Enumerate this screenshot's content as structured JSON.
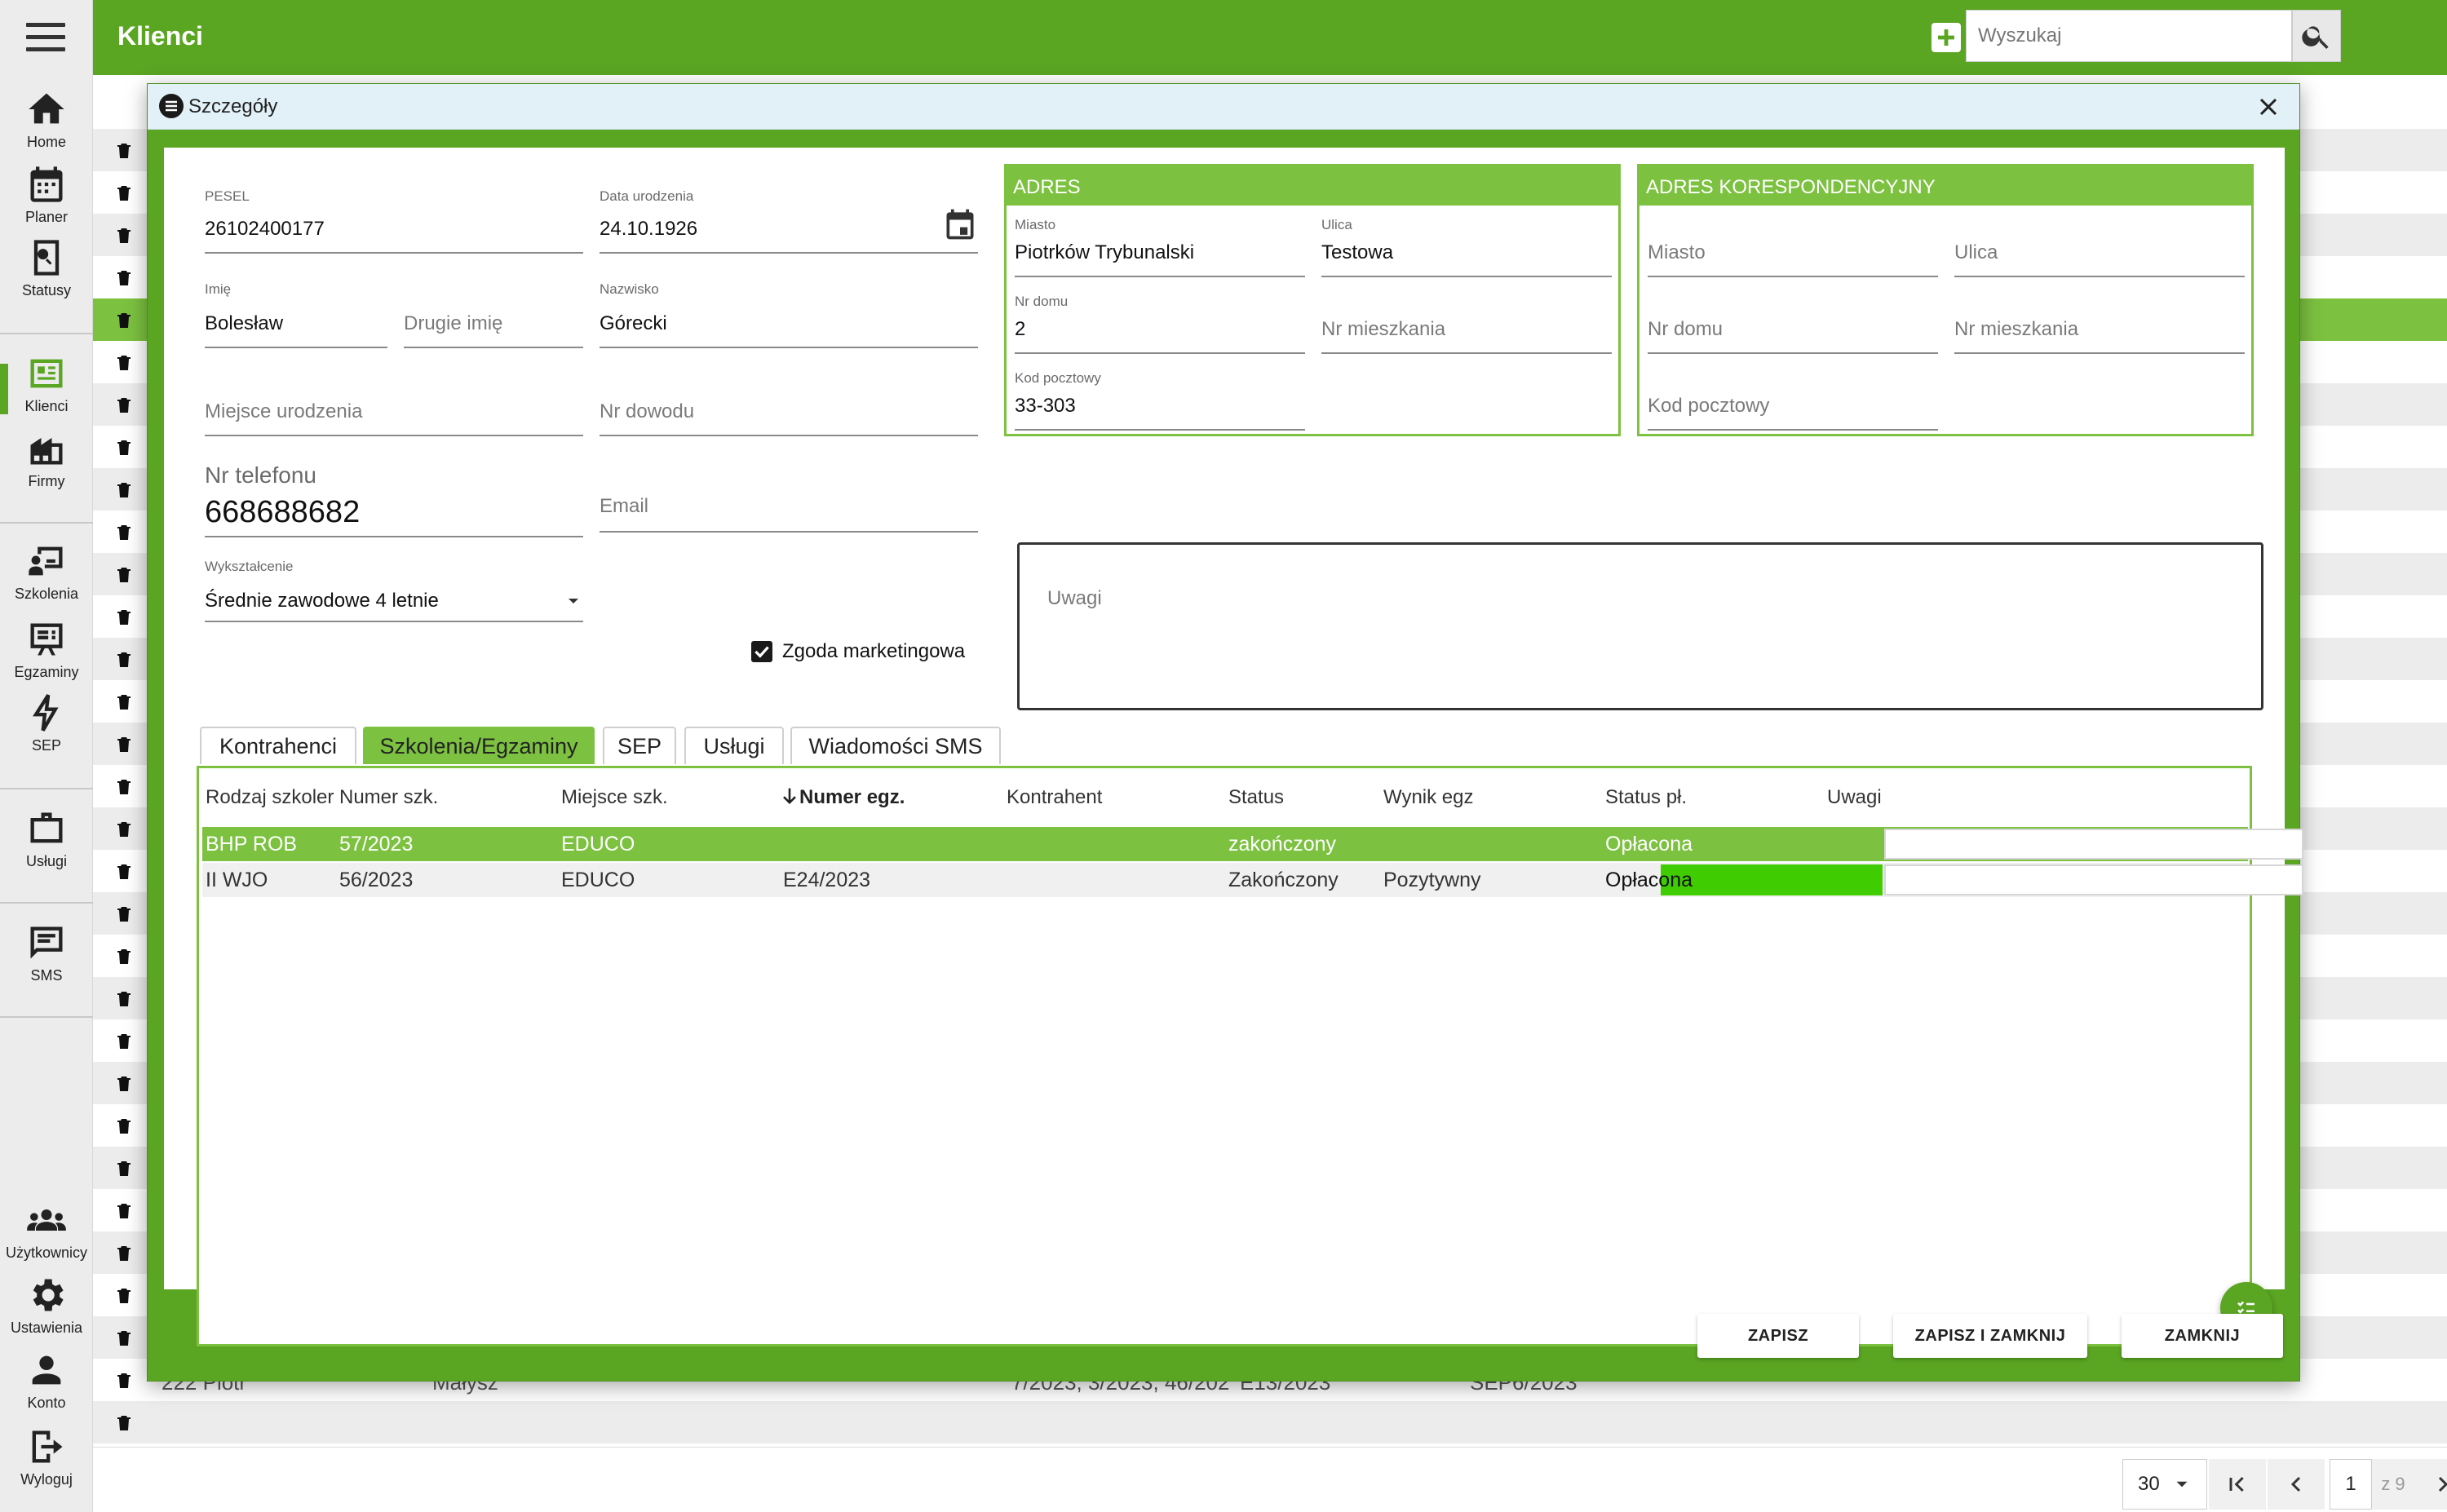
{
  "app": {
    "title": "Klienci",
    "search_placeholder": "Wyszukaj"
  },
  "sidebar": {
    "items": [
      {
        "label": "Home",
        "icon": "home-icon"
      },
      {
        "label": "Planer",
        "icon": "calendar-icon"
      },
      {
        "label": "Statusy",
        "icon": "status-search-icon"
      },
      {
        "label": "Klienci",
        "icon": "client-card-icon",
        "active": true
      },
      {
        "label": "Firmy",
        "icon": "building-icon"
      },
      {
        "label": "Szkolenia",
        "icon": "training-icon"
      },
      {
        "label": "Egzaminy",
        "icon": "exam-icon"
      },
      {
        "label": "SEP",
        "icon": "lightning-icon"
      },
      {
        "label": "Usługi",
        "icon": "briefcase-icon"
      },
      {
        "label": "SMS",
        "icon": "message-icon"
      },
      {
        "label": "Użytkownicy",
        "icon": "users-icon"
      },
      {
        "label": "Ustawienia",
        "icon": "gear-icon"
      },
      {
        "label": "Konto",
        "icon": "account-icon"
      },
      {
        "label": "Wyloguj",
        "icon": "logout-icon"
      }
    ]
  },
  "background_row": {
    "name": "222 Piotr",
    "surname": "Małysz",
    "trainings": "7/2023, 3/2023, 46/202",
    "exams": "E13/2023",
    "sep": "SEP6/2023"
  },
  "pagination": {
    "page_size": "30",
    "current_page": "1",
    "total": "z 9"
  },
  "modal": {
    "title": "Szczegóły",
    "pesel": {
      "label": "PESEL",
      "value": "26102400177"
    },
    "birth_date": {
      "label": "Data urodzenia",
      "value": "24.10.1926"
    },
    "first_name": {
      "label": "Imię",
      "value": "Bolesław"
    },
    "second_name": {
      "placeholder": "Drugie imię"
    },
    "last_name": {
      "label": "Nazwisko",
      "value": "Górecki"
    },
    "birth_place": {
      "placeholder": "Miejsce urodzenia"
    },
    "id_number": {
      "placeholder": "Nr dowodu"
    },
    "phone": {
      "label": "Nr telefonu",
      "value": "668688682"
    },
    "email": {
      "placeholder": "Email"
    },
    "education": {
      "label": "Wykształcenie",
      "value": "Średnie zawodowe 4 letnie"
    },
    "marketing_consent": {
      "label": "Zgoda marketingowa",
      "checked": true
    },
    "address": {
      "header": "ADRES",
      "city": {
        "label": "Miasto",
        "value": "Piotrków Trybunalski"
      },
      "street": {
        "label": "Ulica",
        "value": "Testowa"
      },
      "house_no": {
        "label": "Nr domu",
        "value": "2"
      },
      "flat_no": {
        "placeholder": "Nr mieszkania"
      },
      "postal_code": {
        "label": "Kod pocztowy",
        "value": "33-303"
      }
    },
    "corr_address": {
      "header": "ADRES KORESPONDENCYJNY",
      "city": {
        "placeholder": "Miasto"
      },
      "street": {
        "placeholder": "Ulica"
      },
      "house_no": {
        "placeholder": "Nr domu"
      },
      "flat_no": {
        "placeholder": "Nr mieszkania"
      },
      "postal_code": {
        "placeholder": "Kod pocztowy"
      }
    },
    "notes": {
      "placeholder": "Uwagi"
    },
    "tabs": [
      "Kontrahenci",
      "Szkolenia/Egzaminy",
      "SEP",
      "Usługi",
      "Wiadomości SMS"
    ],
    "active_tab": "Szkolenia/Egzaminy",
    "grid": {
      "columns": [
        "Rodzaj szkoler",
        "Numer szk.",
        "Miejsce szk.",
        "Numer egz.",
        "Kontrahent",
        "Status",
        "Wynik egz",
        "Status pł.",
        "Uwagi"
      ],
      "rows": [
        {
          "type": "BHP ROB",
          "training_no": "57/2023",
          "place": "EDUCO",
          "exam_no": "",
          "contractor": "",
          "status": "zakończony",
          "result": "",
          "payment": "Opłacona",
          "notes": ""
        },
        {
          "type": "II WJO",
          "training_no": "56/2023",
          "place": "EDUCO",
          "exam_no": "E24/2023",
          "contractor": "",
          "status": "Zakończony",
          "result": "Pozytywny",
          "payment": "Opłacona",
          "notes": ""
        }
      ]
    },
    "buttons": {
      "save": "ZAPISZ",
      "save_close": "ZAPISZ I ZAMKNIJ",
      "close": "ZAMKNIJ"
    }
  },
  "colors": {
    "primary": "#5aa522",
    "light_green": "#7cc140",
    "paid_green": "#3fcc00",
    "header_blue": "#e1f1f7"
  }
}
